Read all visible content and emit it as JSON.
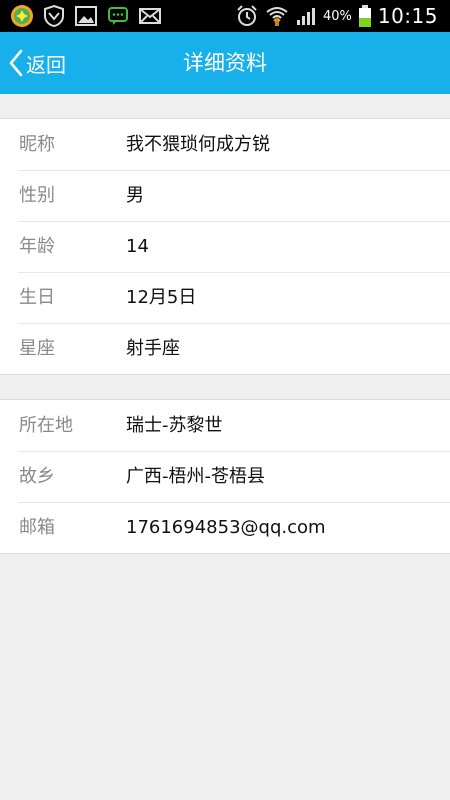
{
  "status_bar": {
    "time": "10:15",
    "battery_percent": "40%",
    "left_icons": [
      "app-notification-icon",
      "shield-icon",
      "image-icon",
      "chat-icon",
      "mail-icon"
    ],
    "right_icons": [
      "alarm-icon",
      "wifi-icon",
      "signal-icon",
      "battery-icon"
    ]
  },
  "header": {
    "back_label": "返回",
    "title": "详细资料",
    "background": "#17b0ea"
  },
  "profile": {
    "basic": [
      {
        "label": "昵称",
        "value": "我不猥琐何成方锐"
      },
      {
        "label": "性别",
        "value": "男"
      },
      {
        "label": "年龄",
        "value": "14"
      },
      {
        "label": "生日",
        "value": "12月5日"
      },
      {
        "label": "星座",
        "value": "射手座"
      }
    ],
    "contact": [
      {
        "label": "所在地",
        "value": "瑞士-苏黎世"
      },
      {
        "label": "故乡",
        "value": "广西-梧州-苍梧县"
      },
      {
        "label": "邮箱",
        "value": "1761694853@qq.com"
      }
    ]
  }
}
